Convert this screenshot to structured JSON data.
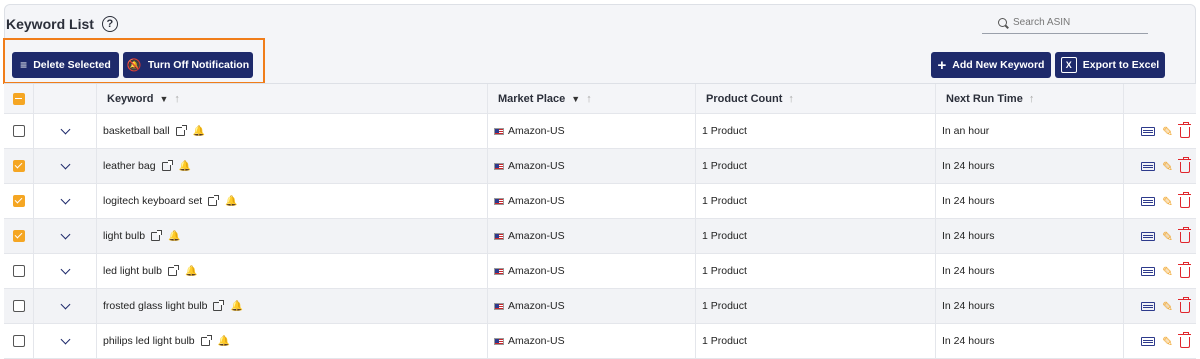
{
  "header": {
    "title": "Keyword List",
    "help_icon": "question-circle-icon",
    "search": {
      "placeholder": "Search ASIN",
      "value": ""
    }
  },
  "toolbar": {
    "delete_label": "Delete Selected",
    "turn_off_label": "Turn Off Notification",
    "add_label": "Add New Keyword",
    "export_label": "Export to Excel",
    "highlight_color": "#f07d1a",
    "button_color": "#1e2a6b"
  },
  "table": {
    "columns": {
      "keyword": "Keyword",
      "market": "Market Place",
      "count": "Product Count",
      "next_run": "Next Run Time"
    },
    "header_checkbox": "indeterminate",
    "rows": [
      {
        "checked": false,
        "keyword": "basketball ball",
        "market": "Amazon-US",
        "count": "1 Product",
        "next_run": "In an hour"
      },
      {
        "checked": true,
        "keyword": "leather bag",
        "market": "Amazon-US",
        "count": "1 Product",
        "next_run": "In 24 hours"
      },
      {
        "checked": true,
        "keyword": "logitech keyboard set",
        "market": "Amazon-US",
        "count": "1 Product",
        "next_run": "In 24 hours"
      },
      {
        "checked": true,
        "keyword": "light bulb",
        "market": "Amazon-US",
        "count": "1 Product",
        "next_run": "In 24 hours"
      },
      {
        "checked": false,
        "keyword": "led light bulb",
        "market": "Amazon-US",
        "count": "1 Product",
        "next_run": "In 24 hours"
      },
      {
        "checked": false,
        "keyword": "frosted glass light bulb",
        "market": "Amazon-US",
        "count": "1 Product",
        "next_run": "In 24 hours"
      },
      {
        "checked": false,
        "keyword": "philips led light bulb",
        "market": "Amazon-US",
        "count": "1 Product",
        "next_run": "In 24 hours"
      }
    ]
  }
}
